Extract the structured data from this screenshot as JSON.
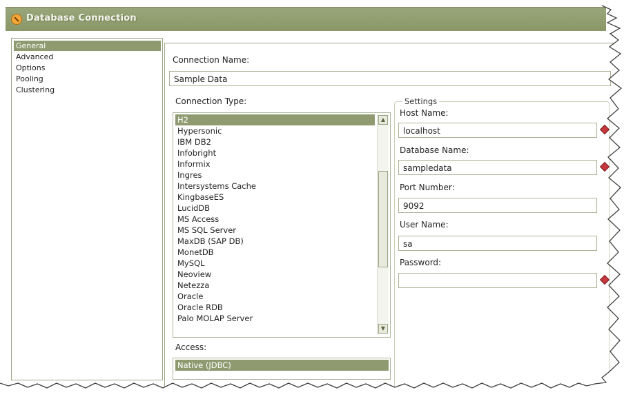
{
  "window": {
    "title": "Database Connection"
  },
  "nav": {
    "items": [
      {
        "label": "General",
        "selected": true
      },
      {
        "label": "Advanced",
        "selected": false
      },
      {
        "label": "Options",
        "selected": false
      },
      {
        "label": "Pooling",
        "selected": false
      },
      {
        "label": "Clustering",
        "selected": false
      }
    ]
  },
  "form": {
    "connection_name_label": "Connection Name:",
    "connection_name_value": "Sample Data",
    "connection_type_label": "Connection Type:",
    "connection_types": [
      {
        "label": "H2",
        "selected": true
      },
      {
        "label": "Hypersonic",
        "selected": false
      },
      {
        "label": "IBM DB2",
        "selected": false
      },
      {
        "label": "Infobright",
        "selected": false
      },
      {
        "label": "Informix",
        "selected": false
      },
      {
        "label": "Ingres",
        "selected": false
      },
      {
        "label": "Intersystems Cache",
        "selected": false
      },
      {
        "label": "KingbaseES",
        "selected": false
      },
      {
        "label": "LucidDB",
        "selected": false
      },
      {
        "label": "MS Access",
        "selected": false
      },
      {
        "label": "MS SQL Server",
        "selected": false
      },
      {
        "label": "MaxDB (SAP DB)",
        "selected": false
      },
      {
        "label": "MonetDB",
        "selected": false
      },
      {
        "label": "MySQL",
        "selected": false
      },
      {
        "label": "Neoview",
        "selected": false
      },
      {
        "label": "Netezza",
        "selected": false
      },
      {
        "label": "Oracle",
        "selected": false
      },
      {
        "label": "Oracle RDB",
        "selected": false
      },
      {
        "label": "Palo MOLAP Server",
        "selected": false
      }
    ],
    "access_label": "Access:",
    "access_options": [
      {
        "label": "Native (JDBC)",
        "selected": true
      }
    ]
  },
  "settings": {
    "legend": "Settings",
    "host_label": "Host Name:",
    "host_value": "localhost",
    "database_label": "Database Name:",
    "database_value": "sampledata",
    "port_label": "Port Number:",
    "port_value": "9092",
    "user_label": "User Name:",
    "user_value": "sa",
    "password_label": "Password:",
    "password_value": ""
  },
  "icons": {
    "app_logo": "app-logo-icon",
    "required": "required-field-icon",
    "scroll_up": "scroll-up-icon",
    "scroll_down": "scroll-down-icon"
  },
  "colors": {
    "titlebar": "#8a9768",
    "selection": "#8f9a70",
    "border": "#aab497",
    "required": "#c6383d"
  }
}
